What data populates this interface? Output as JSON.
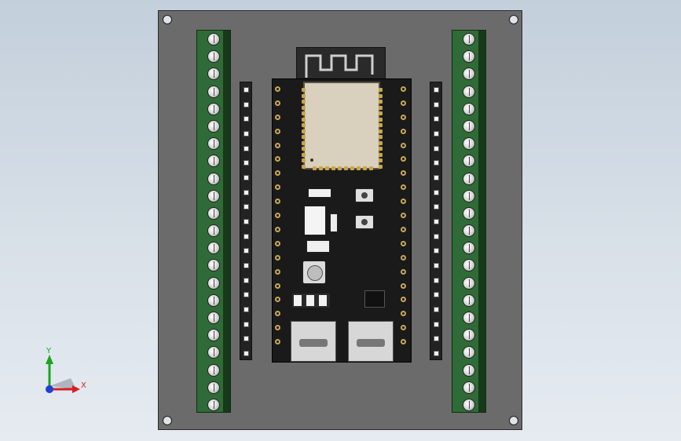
{
  "viewport": {
    "background": "light-blue-gradient"
  },
  "board": {
    "color": "#6b6b6b",
    "terminal_blocks_per_side": 22,
    "header_pins_per_side": 19
  },
  "axis_triad": {
    "x_label": "X",
    "y_label": "Y",
    "x_color": "#d62020",
    "y_color": "#1da41d",
    "z_color": "#1f3fd6"
  }
}
